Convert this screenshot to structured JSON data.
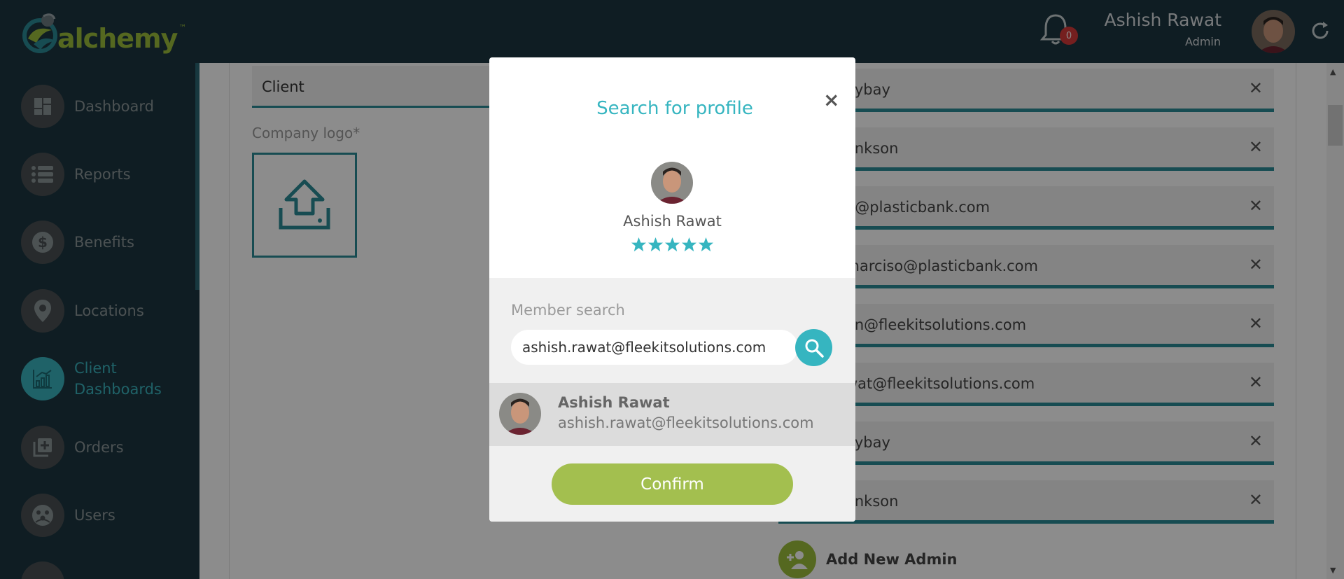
{
  "app": {
    "brand": "alchemy",
    "brand_tm": "™"
  },
  "header": {
    "notifications_count": "0",
    "user_name": "Ashish Rawat",
    "user_role": "Admin"
  },
  "sidebar": {
    "items": [
      {
        "label": "Dashboard",
        "icon": "dashboard-icon"
      },
      {
        "label": "Reports",
        "icon": "list-icon"
      },
      {
        "label": "Benefits",
        "icon": "dollar-icon"
      },
      {
        "label": "Locations",
        "icon": "map-pin-icon"
      },
      {
        "label": "Client Dashboards",
        "label_line1": "Client",
        "label_line2": "Dashboards",
        "icon": "chart-icon",
        "active": true
      },
      {
        "label": "Orders",
        "icon": "add-box-icon"
      },
      {
        "label": "Users",
        "icon": "users-icon"
      }
    ]
  },
  "page": {
    "client_field_value": "Client",
    "company_logo_label": "Company logo*",
    "admins": [
      "aybay",
      "ankson",
      "n@plasticbank.com",
      ".narciso@plasticbank.com",
      "an@fleekitsolutions.com",
      "wat@fleekitsolutions.com",
      "aybay",
      "ankson"
    ],
    "add_admin_label": "Add New Admin"
  },
  "modal": {
    "title": "Search for profile",
    "close_label": "×",
    "profile_name": "Ashish Rawat",
    "rating": 5,
    "search_label": "Member search",
    "search_value": "ashish.rawat@fleekitsolutions.com",
    "result": {
      "name": "Ashish Rawat",
      "email": "ashish.rawat@fleekitsolutions.com"
    },
    "confirm_label": "Confirm"
  },
  "colors": {
    "sidebar_bg": "#1d3640",
    "accent_teal": "#36b5c0",
    "brand_green": "#9cbd3b",
    "confirm_green": "#a3bf4f"
  }
}
